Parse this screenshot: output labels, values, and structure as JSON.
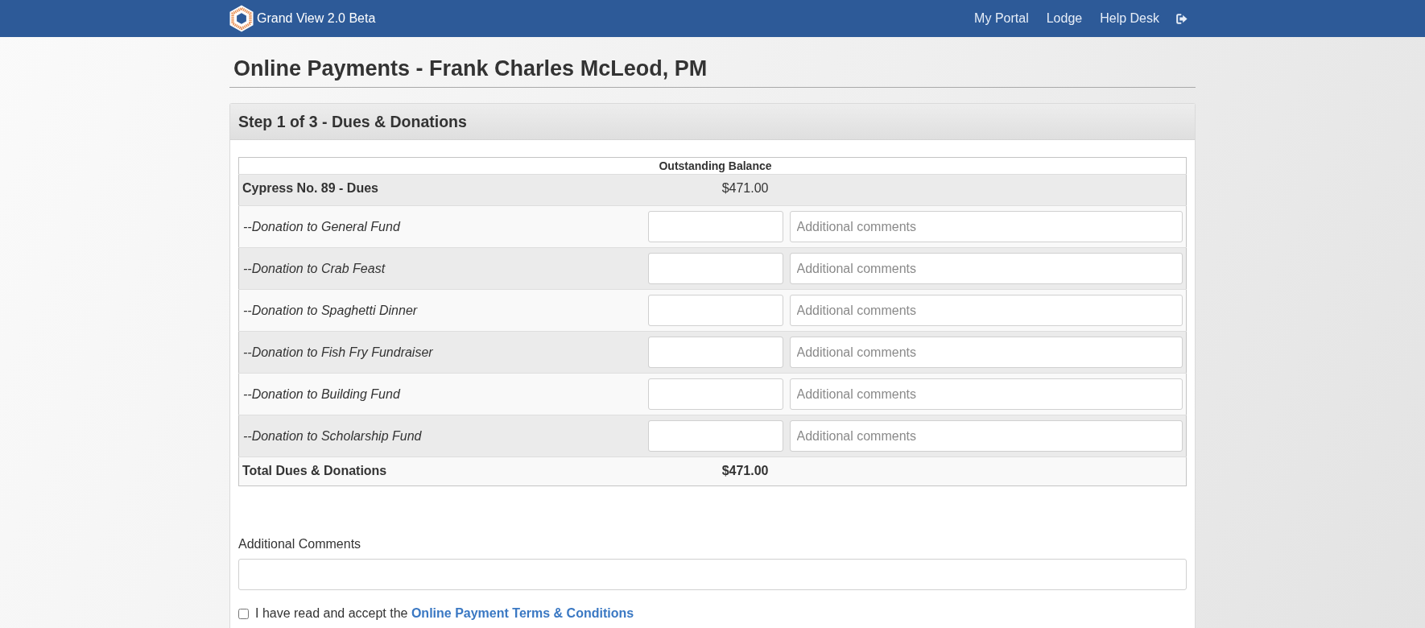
{
  "navbar": {
    "brand": "Grand View 2.0 Beta",
    "links": [
      {
        "label": "My Portal"
      },
      {
        "label": "Lodge"
      },
      {
        "label": "Help Desk"
      }
    ]
  },
  "page_title": "Online Payments - Frank Charles McLeod, PM",
  "panel": {
    "title": "Step 1 of 3 - Dues & Donations",
    "table": {
      "heading": "Outstanding Balance",
      "rows": [
        {
          "kind": "dues",
          "label": "Cypress No. 89 - Dues",
          "amount": "$471.00"
        },
        {
          "kind": "donation",
          "label": "--Donation to General Fund",
          "comment_placeholder": "Additional comments"
        },
        {
          "kind": "donation",
          "label": "--Donation to Crab Feast",
          "comment_placeholder": "Additional comments"
        },
        {
          "kind": "donation",
          "label": "--Donation to Spaghetti Dinner",
          "comment_placeholder": "Additional comments"
        },
        {
          "kind": "donation",
          "label": "--Donation to Fish Fry Fundraiser",
          "comment_placeholder": "Additional comments"
        },
        {
          "kind": "donation",
          "label": "--Donation to Building Fund",
          "comment_placeholder": "Additional comments"
        },
        {
          "kind": "donation",
          "label": "--Donation to Scholarship Fund",
          "comment_placeholder": "Additional comments"
        },
        {
          "kind": "total",
          "label": "Total Dues & Donations",
          "amount": "$471.00"
        }
      ]
    },
    "comments": {
      "label": "Additional Comments"
    },
    "terms": {
      "checked": false,
      "text": "I have read and accept the",
      "link": "Online Payment Terms & Conditions"
    }
  }
}
